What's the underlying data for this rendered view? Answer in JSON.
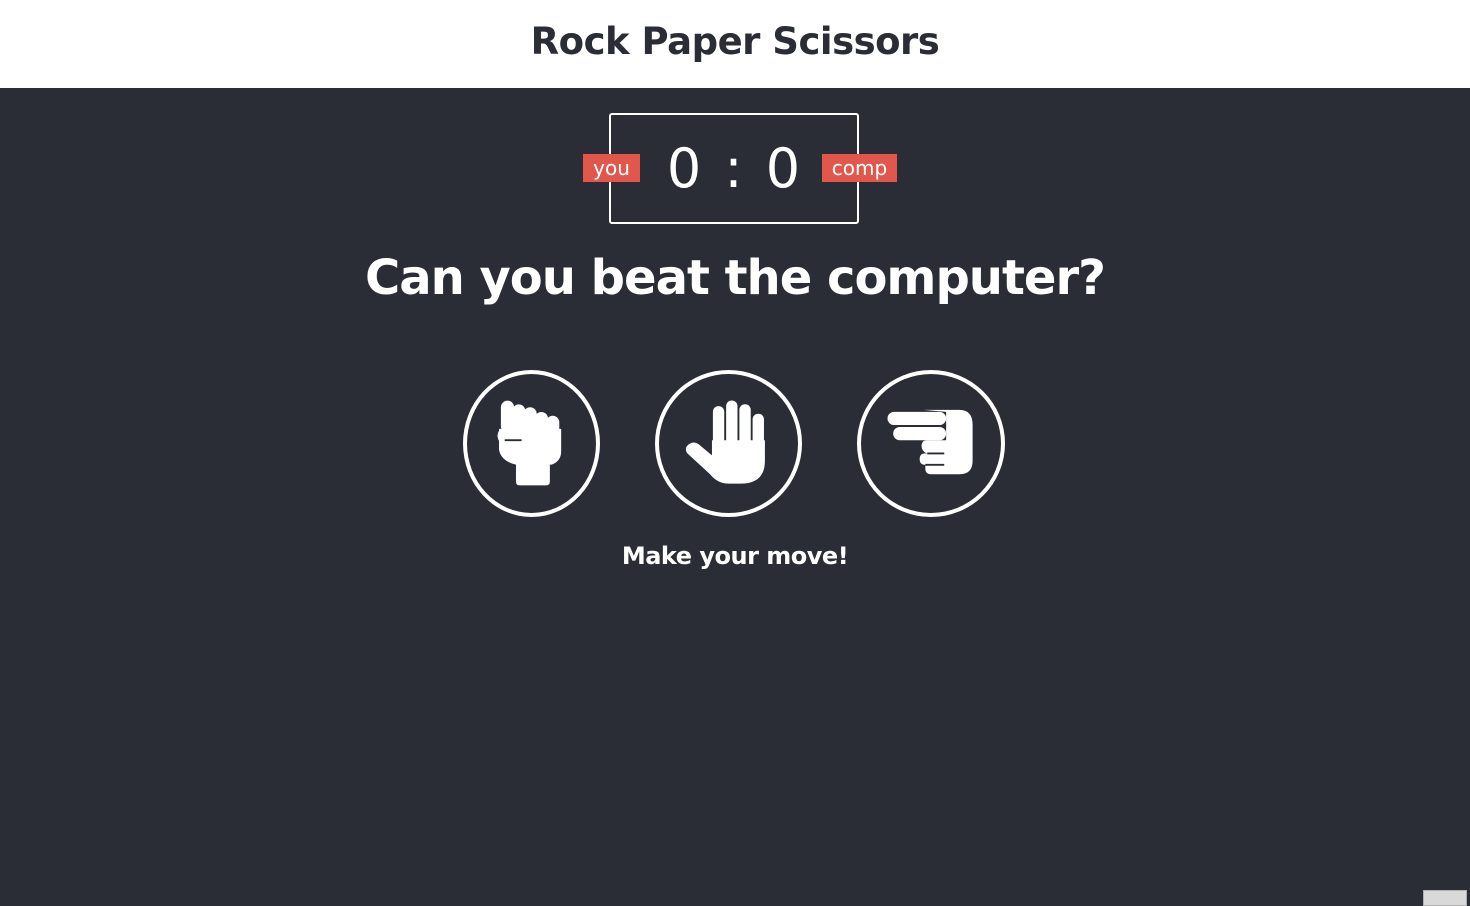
{
  "header": {
    "title": "Rock Paper Scissors"
  },
  "scoreboard": {
    "user_label": "you",
    "computer_label": "comp",
    "user_score": "0",
    "separator": ":",
    "computer_score": "0"
  },
  "prompt": "Can you beat the computer?",
  "choices": [
    {
      "name": "rock",
      "icon": "hand-rock-icon"
    },
    {
      "name": "paper",
      "icon": "hand-paper-icon"
    },
    {
      "name": "scissors",
      "icon": "hand-scissors-icon"
    }
  ],
  "message": "Make your move!",
  "colors": {
    "background": "#2b2d36",
    "header_background": "#ffffff",
    "badge": "#e2574c",
    "foreground": "#ffffff"
  }
}
